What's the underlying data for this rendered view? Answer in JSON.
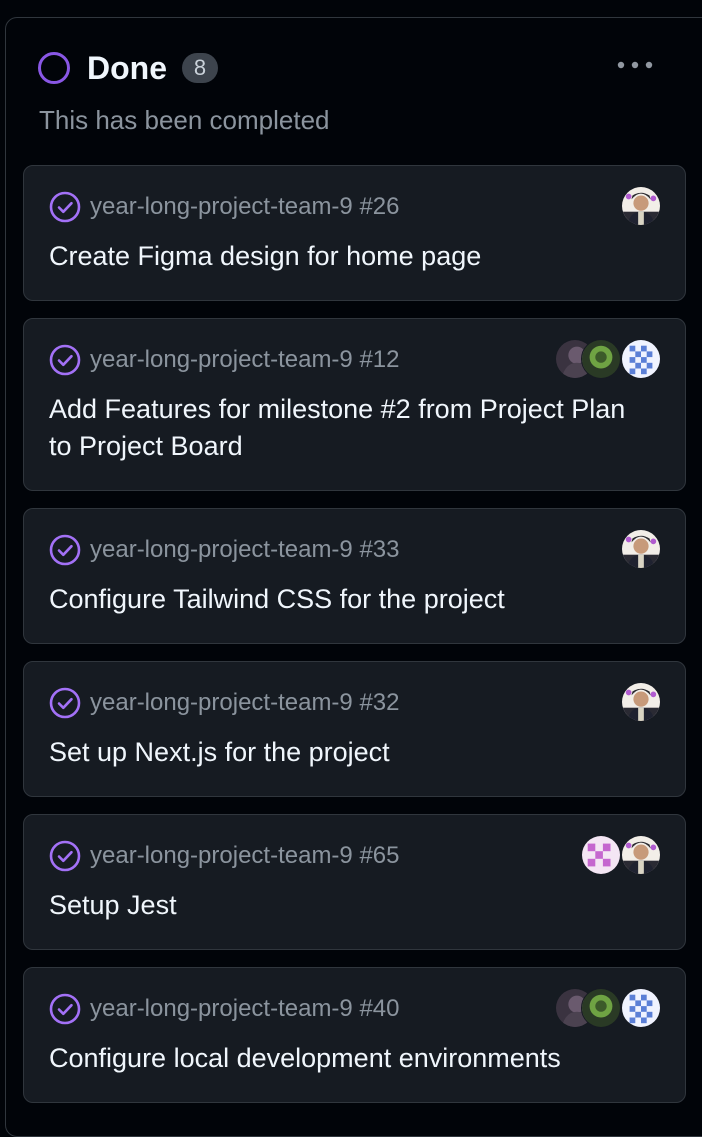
{
  "column": {
    "title": "Done",
    "count": "8",
    "description": "This has been completed",
    "status_color": "#8957e5",
    "more_icon": "kebab-horizontal-icon"
  },
  "cards": [
    {
      "repo": "year-long-project-team-9 #26",
      "title": "Create Figma design for home page",
      "status_icon": "issue-closed-check-icon",
      "assignees": [
        "portrait"
      ]
    },
    {
      "repo": "year-long-project-team-9 #12",
      "title": "Add Features for milestone #2 from Project Plan to Project Board",
      "status_icon": "issue-closed-check-icon",
      "assignees": [
        "blue-checker",
        "green-figure",
        "dark-figure"
      ]
    },
    {
      "repo": "year-long-project-team-9 #33",
      "title": "Configure Tailwind CSS for the project",
      "status_icon": "issue-closed-check-icon",
      "assignees": [
        "portrait"
      ]
    },
    {
      "repo": "year-long-project-team-9 #32",
      "title": "Set up Next.js for the project",
      "status_icon": "issue-closed-check-icon",
      "assignees": [
        "portrait"
      ]
    },
    {
      "repo": "year-long-project-team-9 #65",
      "title": "Setup Jest",
      "status_icon": "issue-closed-check-icon",
      "assignees": [
        "portrait",
        "pink-pattern"
      ]
    },
    {
      "repo": "year-long-project-team-9 #40",
      "title": "Configure local development environments",
      "status_icon": "issue-closed-check-icon",
      "assignees": [
        "blue-checker",
        "green-figure",
        "dark-figure"
      ]
    }
  ]
}
